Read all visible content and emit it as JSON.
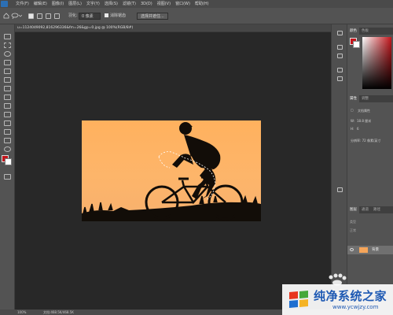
{
  "menubar": {
    "items": [
      "文件(F)",
      "编辑(E)",
      "图像(I)",
      "图层(L)",
      "文字(Y)",
      "选择(S)",
      "滤镜(T)",
      "3D(D)",
      "视图(V)",
      "窗口(W)",
      "帮助(H)"
    ]
  },
  "options": {
    "feather_label": "羽化:",
    "feather_value": "0 像素",
    "antialias_label": "消除锯齿",
    "select_mask_button": "选择并遮住..."
  },
  "document": {
    "tab_title": "u=1124049092,816296336&fm=26&gp=0.jpg @ 100%(RGB/8#)"
  },
  "panels": {
    "color_tab": "颜色",
    "swatches_tab": "色板",
    "properties_tab": "属性",
    "adjustments_tab": "调整",
    "properties_title": "文档属性",
    "w_label": "W:",
    "w_value": "18.8 厘米",
    "h_label": "H:",
    "h_value": "6",
    "resolution": "分辨率: 72 像素/英寸",
    "layers_tab": "图层",
    "channels_tab": "通道",
    "paths_tab": "路径",
    "kind_label": "类型",
    "mode_label": "正常",
    "layer_name": "背景"
  },
  "status": {
    "zoom": "100%",
    "doc_size": "文档:468.5K/468.5K"
  },
  "watermark": {
    "title": "纯净系统之家",
    "url": "www.ycwjzy.com"
  },
  "colors": {
    "foreground": "#c4161c",
    "background": "#ffffff",
    "sky_orange": "#fdb56a",
    "brand_blue": "#1e59b3"
  }
}
